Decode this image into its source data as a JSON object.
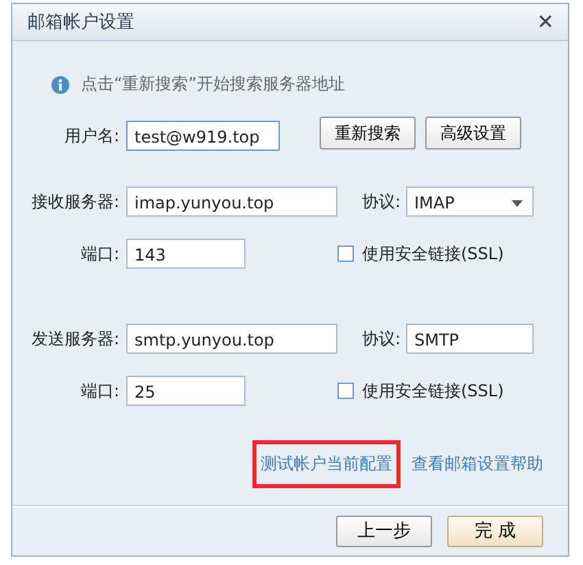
{
  "window": {
    "title": "邮箱帐户设置",
    "close": "✕"
  },
  "hint": "点击“重新搜索”开始搜索服务器地址",
  "username": {
    "label": "用户名:",
    "value": "test@w919.top"
  },
  "top_buttons": [
    "重新搜索",
    "高级设置"
  ],
  "servers": [
    {
      "label": "接收服务器:",
      "value": "imap.yunyou.top",
      "protocol_label": "协议:",
      "protocol": "IMAP",
      "kind": "dropdown",
      "port_label": "端口:",
      "port": "143",
      "ssl_label": "使用安全链接(SSL)",
      "ssl_checked": false
    },
    {
      "label": "发送服务器:",
      "value": "smtp.yunyou.top",
      "protocol_label": "协议:",
      "protocol": "SMTP",
      "kind": "field",
      "port_label": "端口:",
      "port": "25",
      "ssl_label": "使用安全链接(SSL)",
      "ssl_checked": false
    }
  ],
  "links": [
    {
      "label": "测试帐户当前配置",
      "highlighted": true
    },
    {
      "label": "查看邮箱设置帮助",
      "highlighted": false
    }
  ],
  "footer_buttons": [
    {
      "label": "上一步",
      "kind": "normal"
    },
    {
      "label": "完 成",
      "kind": "primary"
    }
  ]
}
